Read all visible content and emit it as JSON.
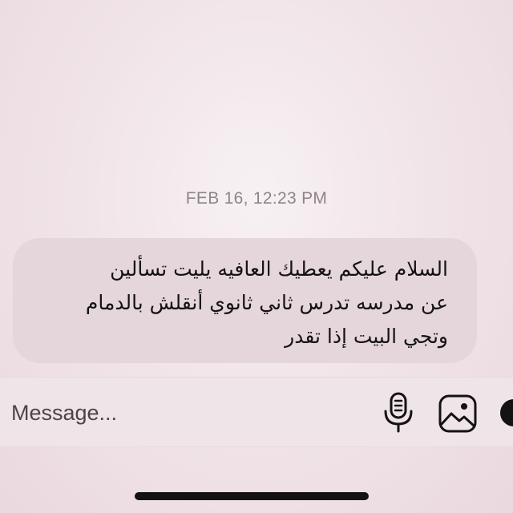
{
  "conversation": {
    "timestamp": "FEB 16, 12:23 PM",
    "messages": [
      {
        "direction": "incoming",
        "lines": [
          "السلام عليكم يعطيك العافيه يليت تسألين",
          "عن مدرسه تدرس ثاني ثانوي أنقلش بالدمام",
          "وتجي البيت إذا تقدر"
        ]
      }
    ]
  },
  "composer": {
    "placeholder": "Message...",
    "value": "",
    "icons": [
      "microphone-icon",
      "gallery-icon",
      "more-icon"
    ]
  },
  "colors": {
    "background": "#f1e5e9",
    "bubble": "#e5d6db",
    "text": "#141214",
    "timestamp": "#8d8588"
  }
}
